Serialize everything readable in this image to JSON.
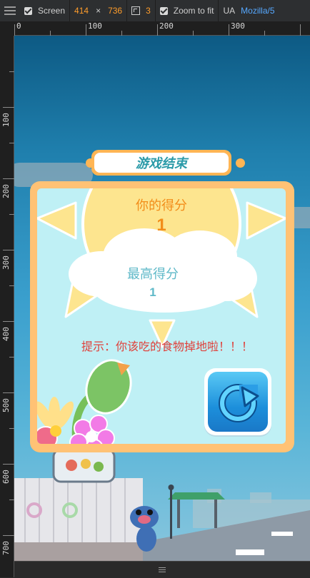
{
  "devtools": {
    "screen_label": "Screen",
    "width": "414",
    "times": "×",
    "height": "736",
    "dpr": "3",
    "zoom_label": "Zoom to fit",
    "ua_label": "UA",
    "ua_value": "Mozilla/5"
  },
  "ruler": {
    "top": [
      "0",
      "100",
      "200",
      "300"
    ],
    "left": [
      "100",
      "200",
      "300",
      "400",
      "500",
      "600",
      "700"
    ]
  },
  "game": {
    "title": "游戏结束",
    "your_score_label": "你的得分",
    "your_score": "1",
    "best_score_label": "最高得分",
    "best_score": "1",
    "hint": "提示：你该吃的食物掉地啦！！！"
  },
  "colors": {
    "panel_border": "#ffc275",
    "panel_bg": "#bff0f5",
    "score_orange": "#f28d1a",
    "best_score_teal": "#5fb9c8",
    "hint_red": "#e0403a",
    "title_teal": "#2a9aa8"
  },
  "icons": {
    "replay": "replay-icon"
  }
}
